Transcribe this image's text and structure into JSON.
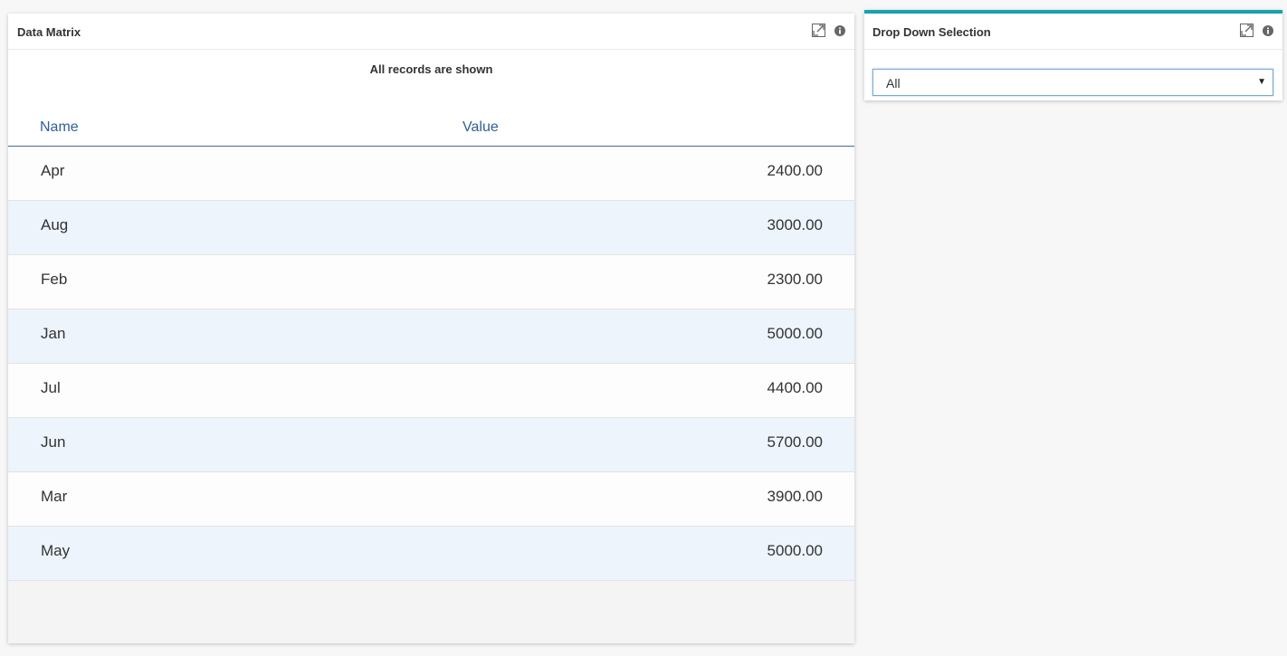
{
  "matrix": {
    "title": "Data Matrix",
    "notice": "All records are shown",
    "columns": {
      "name": "Name",
      "value": "Value"
    },
    "rows": [
      {
        "name": "Apr",
        "value": "2400.00"
      },
      {
        "name": "Aug",
        "value": "3000.00"
      },
      {
        "name": "Feb",
        "value": "2300.00"
      },
      {
        "name": "Jan",
        "value": "5000.00"
      },
      {
        "name": "Jul",
        "value": "4400.00"
      },
      {
        "name": "Jun",
        "value": "5700.00"
      },
      {
        "name": "Mar",
        "value": "3900.00"
      },
      {
        "name": "May",
        "value": "5000.00"
      }
    ],
    "icons": [
      "expand-icon",
      "info-icon"
    ]
  },
  "dropdown": {
    "title": "Drop Down Selection",
    "selected": "All",
    "accent_color": "#17a3ad",
    "icons": [
      "expand-icon",
      "info-icon"
    ]
  },
  "colors": {
    "header_text": "#2f6096",
    "alt_row": "#edf4fc",
    "accent": "#17a3ad"
  }
}
